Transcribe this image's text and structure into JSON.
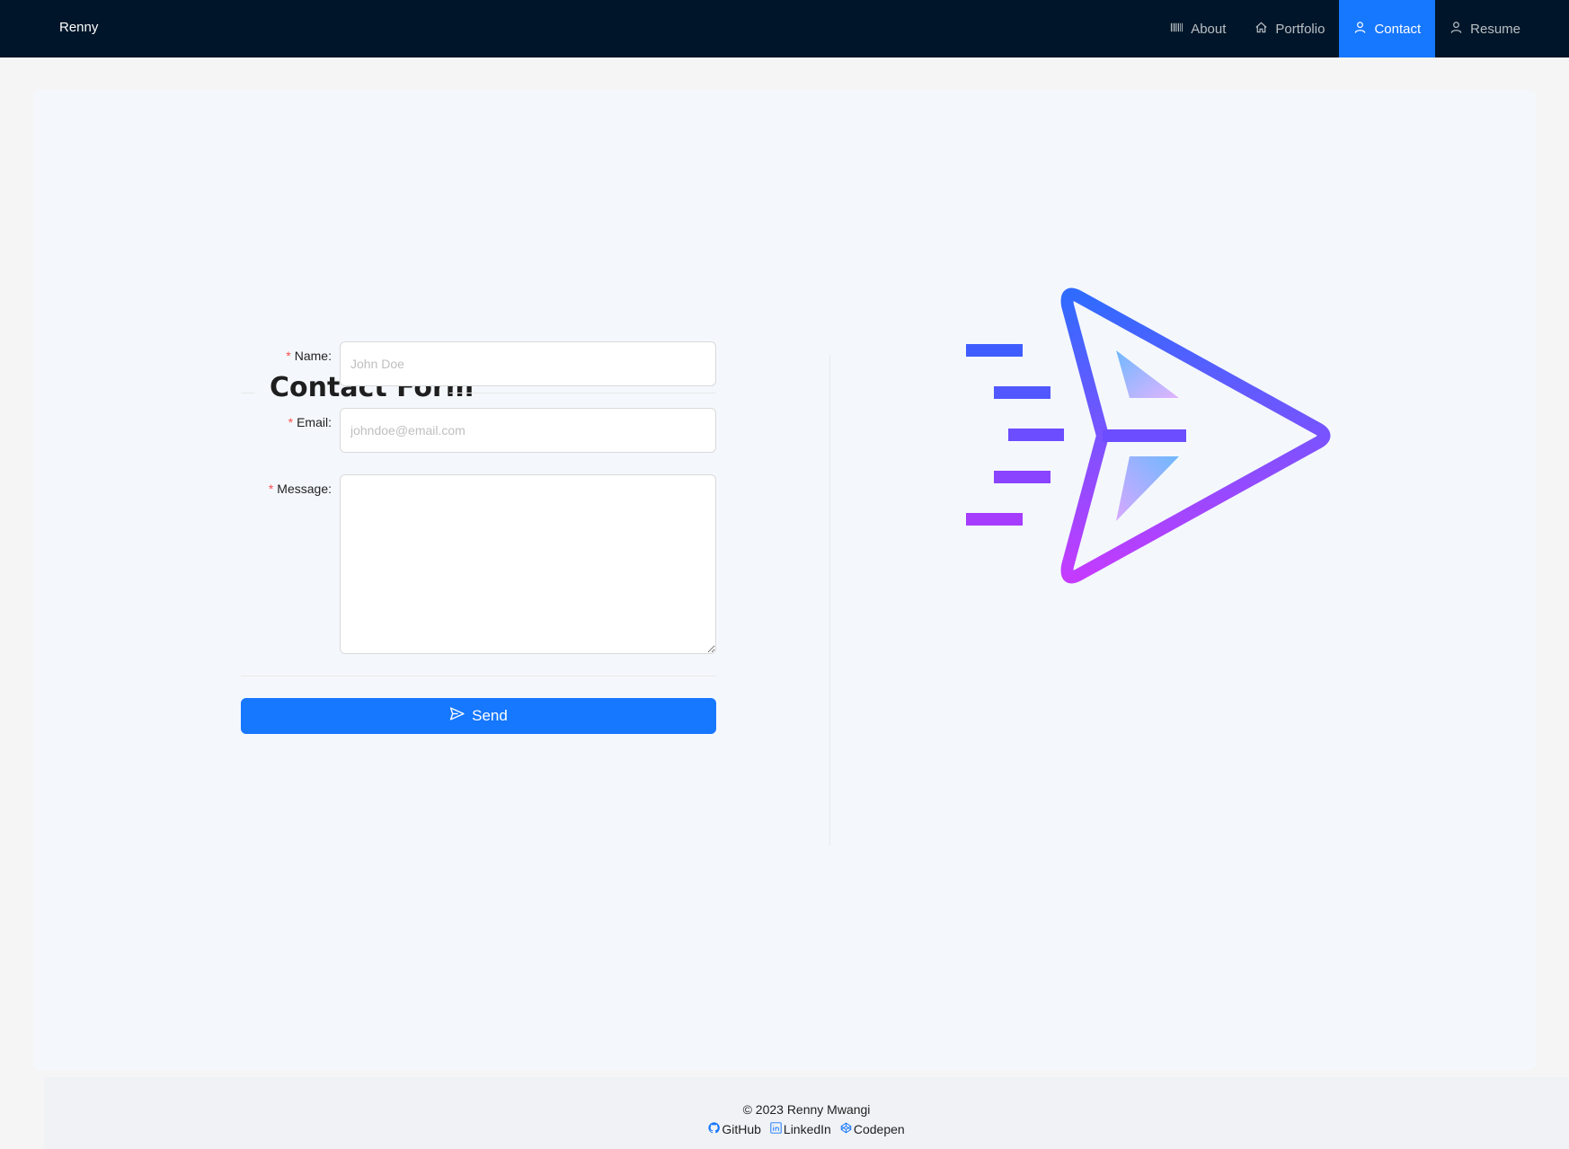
{
  "header": {
    "brand": "Renny",
    "nav": [
      {
        "label": "About",
        "icon": "barcode-icon",
        "active": false
      },
      {
        "label": "Portfolio",
        "icon": "home-icon",
        "active": false
      },
      {
        "label": "Contact",
        "icon": "user-icon",
        "active": true
      },
      {
        "label": "Resume",
        "icon": "user-icon",
        "active": false
      }
    ]
  },
  "form": {
    "title": "Contact Form",
    "name": {
      "label": "Name",
      "placeholder": "John Doe",
      "value": ""
    },
    "email": {
      "label": "Email",
      "placeholder": "johndoe@email.com",
      "value": ""
    },
    "message": {
      "label": "Message",
      "value": ""
    },
    "send_label": "Send"
  },
  "footer": {
    "copyright": "© 2023 Renny Mwangi",
    "links": [
      {
        "label": "GitHub",
        "icon": "github-icon"
      },
      {
        "label": "LinkedIn",
        "icon": "linkedin-icon"
      },
      {
        "label": "Codepen",
        "icon": "codepen-icon"
      }
    ]
  },
  "colors": {
    "header_bg": "#001529",
    "accent": "#1677ff",
    "required": "#ff4d4f",
    "illustration_gradient_start": "#2f6bff",
    "illustration_gradient_end": "#c43bff"
  }
}
